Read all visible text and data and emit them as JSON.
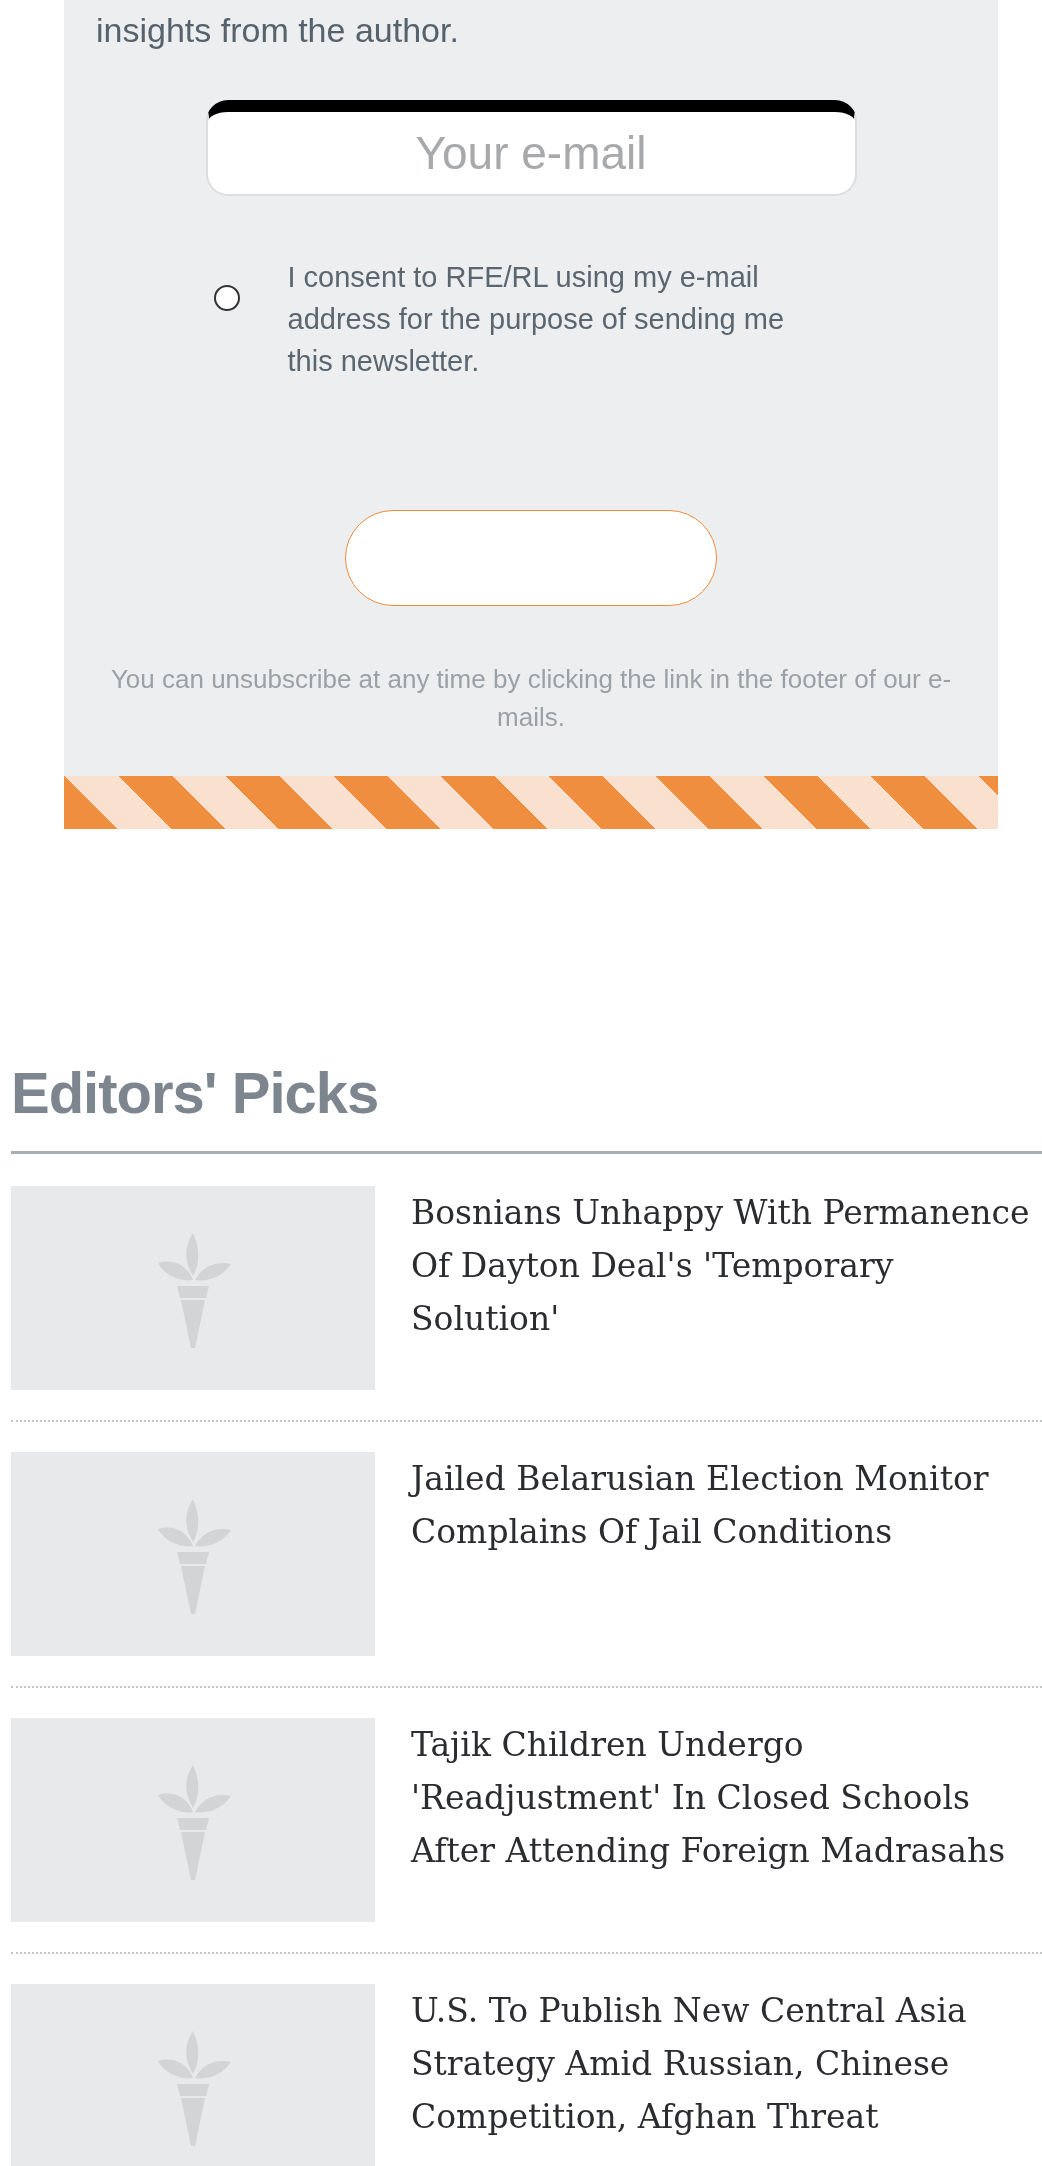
{
  "newsletter": {
    "intro": "insights from the author.",
    "email": {
      "placeholder": "Your e-mail"
    },
    "consent": {
      "checked": false,
      "label": "I consent to RFE/RL using my e-mail address for the purpose of sending me this newsletter."
    },
    "note": "You can unsubscribe at any time by clicking the link in the footer of our e-mails."
  },
  "section_title": "Editors' Picks",
  "articles": [
    {
      "title": "Bosnians Unhappy With Permanence Of Dayton Deal's 'Temporary Solution'"
    },
    {
      "title": "Jailed Belarusian Election Monitor Complains Of Jail Conditions"
    },
    {
      "title": "Tajik Children Undergo 'Readjustment' In Closed Schools After Attending Foreign Madrasahs"
    },
    {
      "title": "U.S. To Publish New Central Asia Strategy Amid Russian, Chinese Competition, Afghan Threat"
    }
  ]
}
